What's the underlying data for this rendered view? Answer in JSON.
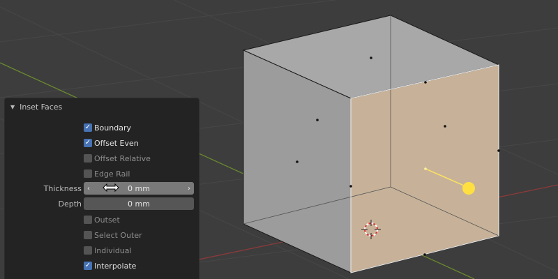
{
  "panel": {
    "title": "Inset Faces",
    "options": [
      {
        "label": "Boundary",
        "checked": true
      },
      {
        "label": "Offset Even",
        "checked": true
      },
      {
        "label": "Offset Relative",
        "checked": false
      },
      {
        "label": "Edge Rail",
        "checked": false
      }
    ],
    "thickness": {
      "label": "Thickness",
      "value": "0 mm"
    },
    "depth": {
      "label": "Depth",
      "value": "0 mm"
    },
    "options2": [
      {
        "label": "Outset",
        "checked": false
      },
      {
        "label": "Select Outer",
        "checked": false
      },
      {
        "label": "Individual",
        "checked": false
      },
      {
        "label": "Interpolate",
        "checked": true
      }
    ]
  },
  "colors": {
    "viewport_bg": "#3d3d3d",
    "panel_bg": "#232323",
    "checkbox_on": "#4772b3",
    "selected_face": "#c7b299",
    "x_axis": "#8b3a3a",
    "y_axis": "#6a8a2e",
    "light": "#ffe040"
  },
  "icons": {
    "disclosure": "triangle-down-icon",
    "cursor": "horizontal-resize-cursor-icon",
    "origin": "3d-cursor-icon"
  }
}
